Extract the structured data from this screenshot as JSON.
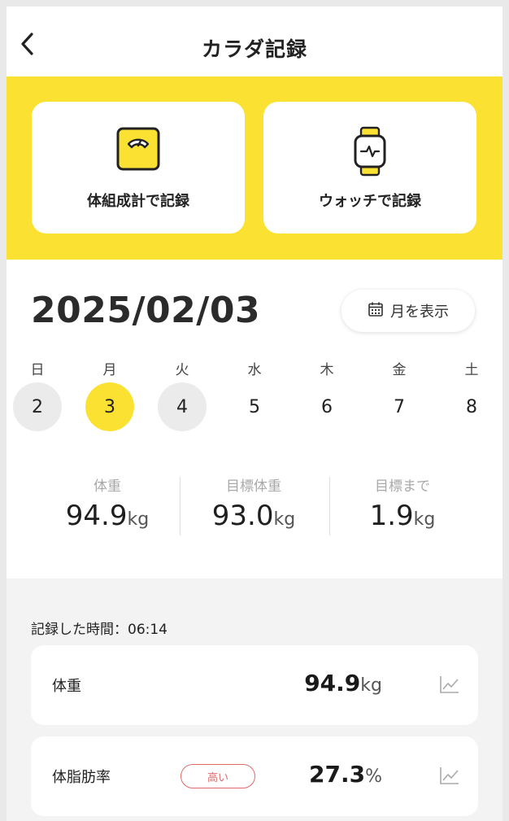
{
  "header": {
    "back_icon": "chevron-left-icon",
    "title": "カラダ記録"
  },
  "record_options": [
    {
      "label": "体組成計で記録",
      "icon": "scale-icon"
    },
    {
      "label": "ウォッチで記録",
      "icon": "smartwatch-icon"
    }
  ],
  "date": {
    "current": "2025/02/03",
    "month_button_label": "月を表示",
    "month_button_icon": "calendar-icon"
  },
  "week": {
    "weekdays": [
      "日",
      "月",
      "火",
      "水",
      "木",
      "金",
      "土"
    ],
    "days": [
      {
        "num": "2",
        "state": "has-record"
      },
      {
        "num": "3",
        "state": "selected"
      },
      {
        "num": "4",
        "state": "has-record"
      },
      {
        "num": "5",
        "state": "none"
      },
      {
        "num": "6",
        "state": "none"
      },
      {
        "num": "7",
        "state": "none"
      },
      {
        "num": "8",
        "state": "none"
      }
    ]
  },
  "summary": [
    {
      "label": "体重",
      "value": "94.9",
      "unit": "kg"
    },
    {
      "label": "目標体重",
      "value": "93.0",
      "unit": "kg"
    },
    {
      "label": "目標まで",
      "value": "1.9",
      "unit": "kg"
    }
  ],
  "records": {
    "recorded_time_label": "記録した時間：06:14",
    "items": [
      {
        "name": "体重",
        "value": "94.9",
        "unit": "kg",
        "badge": "",
        "chart_icon": "line-chart-icon"
      },
      {
        "name": "体脂肪率",
        "value": "27.3",
        "unit": "%",
        "badge": "高い",
        "chart_icon": "line-chart-icon"
      }
    ]
  },
  "colors": {
    "accent_yellow": "#fbe232",
    "badge_red": "#e06a6a",
    "records_bg": "#f3f3f3"
  }
}
